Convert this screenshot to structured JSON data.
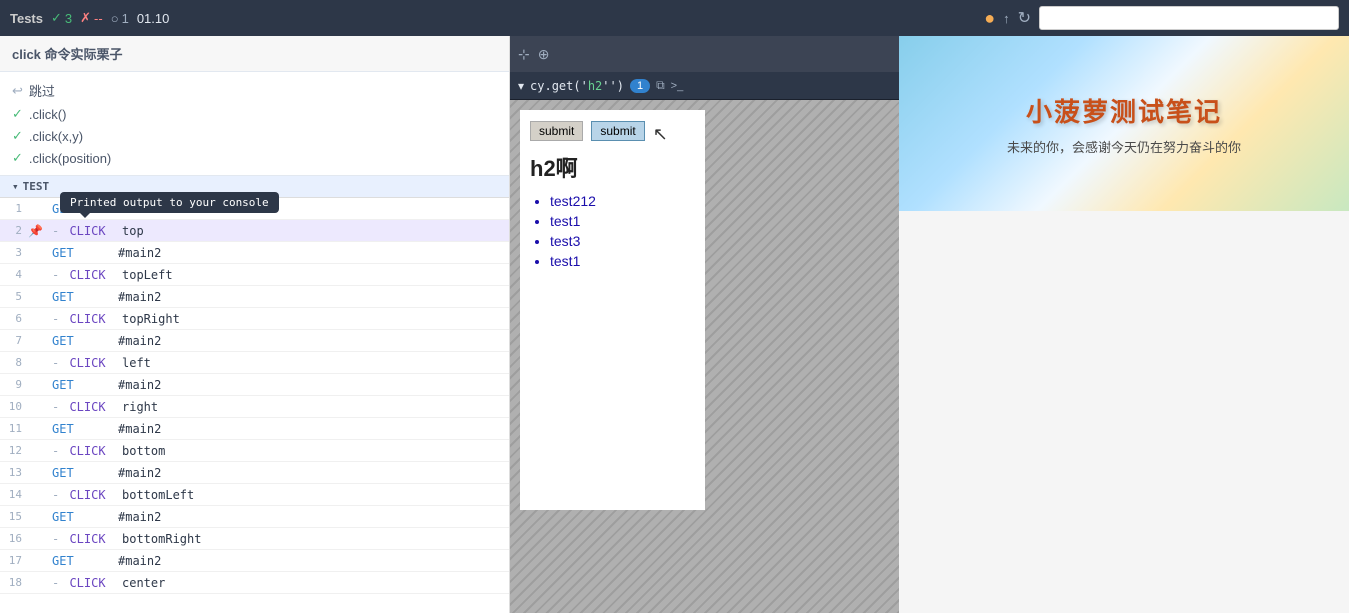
{
  "topbar": {
    "tests_label": "Tests",
    "badge_green": "3",
    "badge_red": "--",
    "badge_circle": "1",
    "badge_time": "01.10",
    "url_placeholder": ""
  },
  "left_panel": {
    "section_title": "click 命令实际栗子",
    "nav_items": [
      {
        "id": "skip",
        "label": "跳过",
        "icon": "↩",
        "check": false
      },
      {
        "id": "click_plain",
        "label": ".click()",
        "check": true
      },
      {
        "id": "click_xy",
        "label": ".click(x,y)",
        "check": true
      },
      {
        "id": "click_position",
        "label": ".click(position)",
        "check": true
      }
    ],
    "test_group": "TEST",
    "rows": [
      {
        "num": "1",
        "method": "GET",
        "dash": "",
        "value": "#main2",
        "highlighted": false,
        "pin": false
      },
      {
        "num": "2",
        "method": "CLICK",
        "dash": "-",
        "value": "top",
        "highlighted": true,
        "pin": true
      },
      {
        "num": "3",
        "method": "GET",
        "dash": "",
        "value": "#main2",
        "highlighted": false,
        "pin": false
      },
      {
        "num": "4",
        "method": "CLICK",
        "dash": "-",
        "value": "topLeft",
        "highlighted": false,
        "pin": false
      },
      {
        "num": "5",
        "method": "GET",
        "dash": "",
        "value": "#main2",
        "highlighted": false,
        "pin": false
      },
      {
        "num": "6",
        "method": "CLICK",
        "dash": "-",
        "value": "topRight",
        "highlighted": false,
        "pin": false
      },
      {
        "num": "7",
        "method": "GET",
        "dash": "",
        "value": "#main2",
        "highlighted": false,
        "pin": false
      },
      {
        "num": "8",
        "method": "CLICK",
        "dash": "-",
        "value": "left",
        "highlighted": false,
        "pin": false
      },
      {
        "num": "9",
        "method": "GET",
        "dash": "",
        "value": "#main2",
        "highlighted": false,
        "pin": false
      },
      {
        "num": "10",
        "method": "CLICK",
        "dash": "-",
        "value": "right",
        "highlighted": false,
        "pin": false
      },
      {
        "num": "11",
        "method": "GET",
        "dash": "",
        "value": "#main2",
        "highlighted": false,
        "pin": false
      },
      {
        "num": "12",
        "method": "CLICK",
        "dash": "-",
        "value": "bottom",
        "highlighted": false,
        "pin": false
      },
      {
        "num": "13",
        "method": "GET",
        "dash": "",
        "value": "#main2",
        "highlighted": false,
        "pin": false
      },
      {
        "num": "14",
        "method": "CLICK",
        "dash": "-",
        "value": "bottomLeft",
        "highlighted": false,
        "pin": false
      },
      {
        "num": "15",
        "method": "GET",
        "dash": "",
        "value": "#main2",
        "highlighted": false,
        "pin": false
      },
      {
        "num": "16",
        "method": "CLICK",
        "dash": "-",
        "value": "bottomRight",
        "highlighted": false,
        "pin": false
      },
      {
        "num": "17",
        "method": "GET",
        "dash": "",
        "value": "#main2",
        "highlighted": false,
        "pin": false
      },
      {
        "num": "18",
        "method": "CLICK",
        "dash": "-",
        "value": "center",
        "highlighted": false,
        "pin": false
      }
    ]
  },
  "browser": {
    "selector": "cy.get('",
    "selector_tag": "h2",
    "selector_close": "')",
    "badge_count": "1",
    "submit_label": "submit",
    "submit2_label": "submit",
    "h2_title": "h2啊",
    "list_items": [
      "test212",
      "test1",
      "test3",
      "test1"
    ]
  },
  "tooltip": {
    "text": "Printed output to your console"
  },
  "banner": {
    "title": "小菠萝测试笔记",
    "subtitle": "未来的你，会感谢今天仍在努力奋斗的你"
  },
  "icons": {
    "check": "✓",
    "cross": "✗",
    "circle": "○",
    "arrow_up": "↑",
    "refresh": "↻",
    "cursor": "⊕",
    "inspect": "⊹",
    "copy": "⧉",
    "terminal": ">_",
    "chevron": "▾",
    "pin": "📌"
  }
}
